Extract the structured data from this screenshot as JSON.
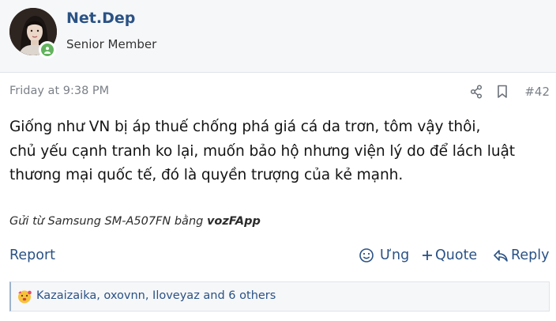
{
  "user": {
    "name": "Net.Dep",
    "title": "Senior Member"
  },
  "post": {
    "date": "Friday at 9:38 PM",
    "number": "#42",
    "lines": [
      "Giống như VN bị áp thuế chống phá giá cá da trơn, tôm vậy thôi,",
      "chủ yếu cạnh tranh ko lại, muốn bảo hộ nhưng viện lý do để lách luật",
      "thương mại quốc tế, đó là quyền trượng của kẻ mạnh."
    ],
    "signature_prefix": "Gửi từ Samsung SM-A507FN bằng ",
    "signature_app": "vozFApp"
  },
  "actions": {
    "report": "Report",
    "react": "Ưng",
    "quote": "Quote",
    "reply": "Reply"
  },
  "reactions": {
    "text": "Kazaizaika, oxovnn, Iloveyaz and 6 others"
  },
  "colors": {
    "link": "#2a5285",
    "online": "#63b35e",
    "muted": "#7b8188"
  }
}
